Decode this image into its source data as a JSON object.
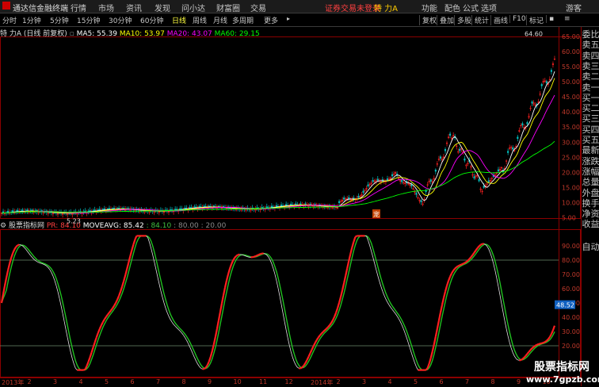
{
  "menu": {
    "app_name": "通达信金融终端",
    "items": [
      "行情",
      "市场",
      "资讯",
      "发现",
      "问小达",
      "财富圈",
      "交易"
    ],
    "notice": "证券交易未登录",
    "stock_title": "特 力A",
    "right_items": [
      "功能",
      "配色",
      "公式",
      "选项",
      "游客"
    ]
  },
  "toolbar": {
    "periods": [
      "分时",
      "1分钟",
      "5分钟",
      "15分钟",
      "30分钟",
      "60分钟",
      "日线",
      "周线",
      "月线",
      "多周期",
      "更多"
    ],
    "active_period": "日线",
    "tools": [
      "复权",
      "叠加",
      "多股",
      "统计",
      "画线",
      "F10",
      "标记"
    ]
  },
  "main_legend": {
    "name": "特 力A (日线 前复权)",
    "ma5": "MA5: 55.39",
    "ma10": "MA10: 53.97",
    "ma20": "MA20: 43.07",
    "ma60": "MA60: 29.15"
  },
  "price_axis": [
    "65.00",
    "60.00",
    "55.00",
    "50.00",
    "45.00",
    "40.00",
    "35.00",
    "30.00",
    "25.00",
    "20.00",
    "15.00",
    "10.00",
    "5.00"
  ],
  "annotations": {
    "high_label": "64.60",
    "low_label": "5.23",
    "marker": "宠"
  },
  "indicator_legend": {
    "name": "股票指标网",
    "pr": "PR: 84.10",
    "moveavg": "MOVEAVG: 85.42",
    "v1": ": 84.10",
    "v2": ": 80.00",
    "v3": ": 20.00"
  },
  "indicator_axis": [
    "90.00",
    "80.00",
    "70.00",
    "60.00",
    "50.00",
    "40.00",
    "30.00",
    "20.00"
  ],
  "indicator_current": "48.52",
  "side_panel": [
    "委比",
    "卖五",
    "卖四",
    "卖三",
    "卖二",
    "卖一",
    "买一",
    "买二",
    "买三",
    "买四",
    "买五",
    "最新",
    "涨跌",
    "涨幅",
    "总量",
    "外盘",
    "换手",
    "净资",
    "收益",
    "自动"
  ],
  "xaxis": [
    "2013年",
    "2",
    "3",
    "4",
    "5",
    "6",
    "7",
    "8",
    "9",
    "10",
    "11",
    "12",
    "2014年",
    "2",
    "3",
    "4",
    "5",
    "6",
    "7",
    "8",
    "9",
    "10"
  ],
  "watermark": {
    "title": "股票指标网",
    "url": "www.7gpzb.com"
  },
  "colors": {
    "ma5": "#ffffff",
    "ma10": "#ffff00",
    "ma20": "#ff00ff",
    "ma60": "#00ff00",
    "up": "#ff2020",
    "down": "#00c0c0",
    "axis": "#c0392b",
    "pr_up": "#ff2020",
    "pr_down": "#20c020"
  }
}
